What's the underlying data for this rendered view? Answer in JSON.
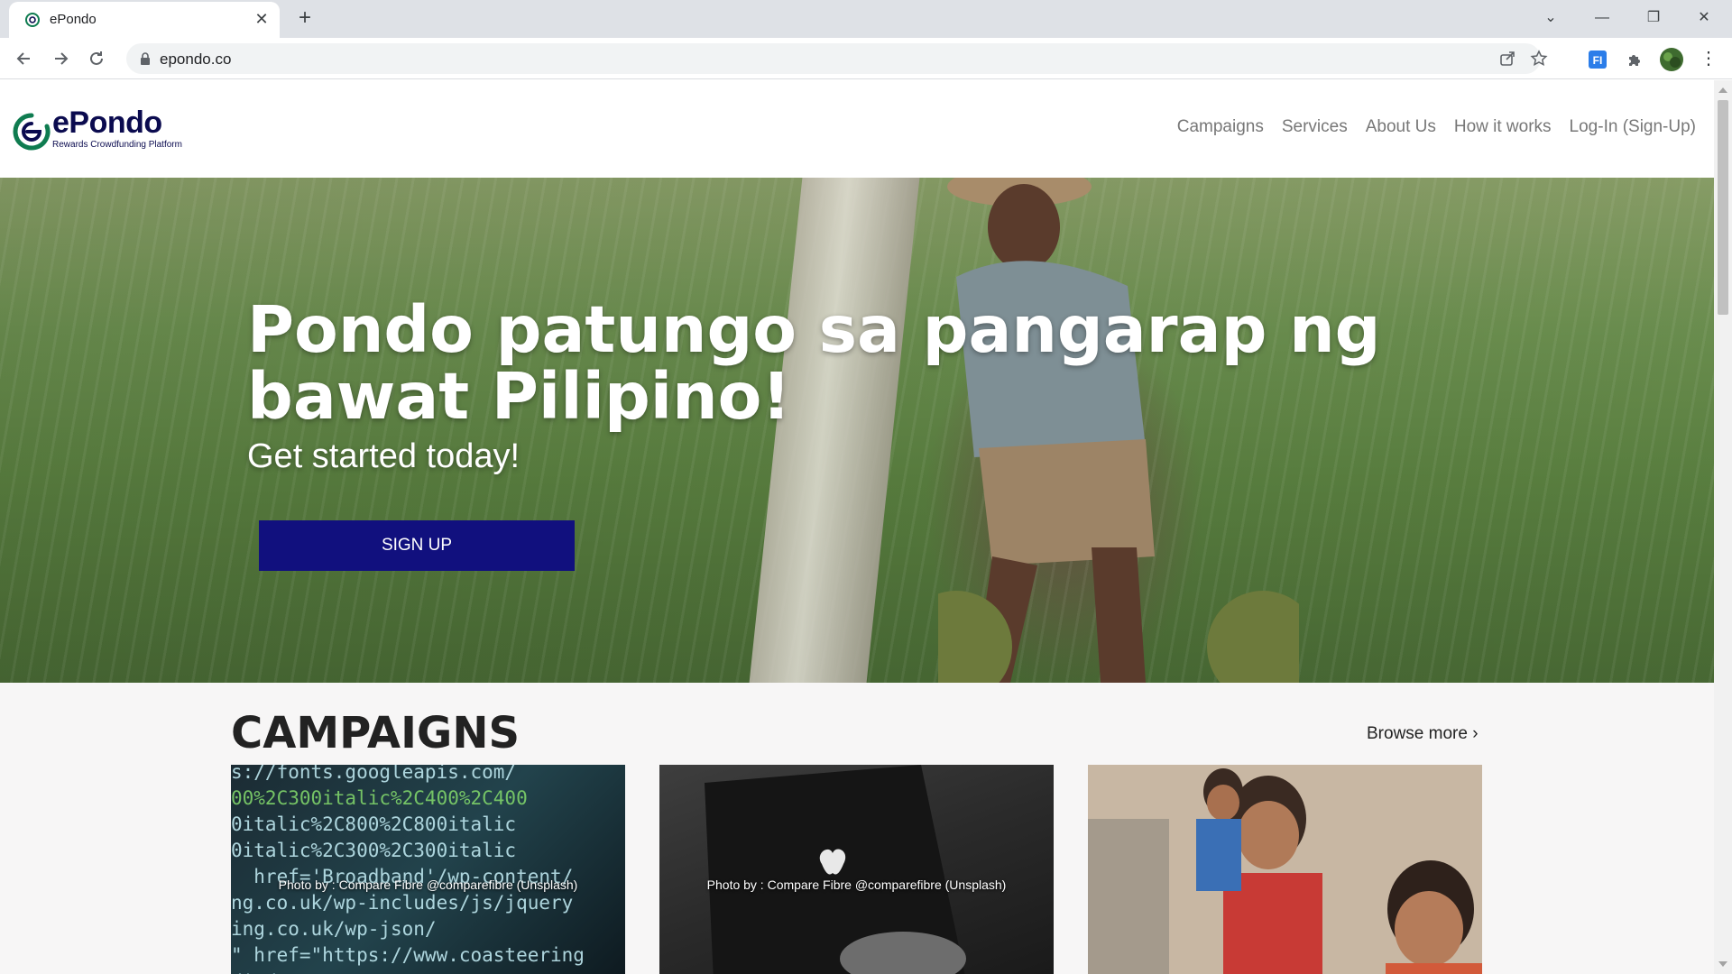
{
  "browser": {
    "tab_title": "ePondo",
    "url": "epondo.co"
  },
  "site": {
    "logo_text": "ePondo",
    "logo_tagline": "Rewards Crowdfunding Platform",
    "nav": [
      "Campaigns",
      "Services",
      "About Us",
      "How it works",
      "Log-In (Sign-Up)"
    ]
  },
  "hero": {
    "title": "Pondo patungo sa pangarap ng bawat Pilipino!",
    "subtitle": "Get started today!",
    "cta": "SIGN UP"
  },
  "campaigns": {
    "heading": "CAMPAIGNS",
    "browse_more": "Browse more ›",
    "cards": [
      {
        "credit": "Photo by : Compare Fibre @comparefibre (Unsplash)"
      },
      {
        "credit": "Photo by : Compare Fibre @comparefibre (Unsplash)"
      },
      {
        "credit": ""
      }
    ]
  },
  "colors": {
    "brand_navy": "#11107e",
    "brand_green": "#0f7c50"
  }
}
